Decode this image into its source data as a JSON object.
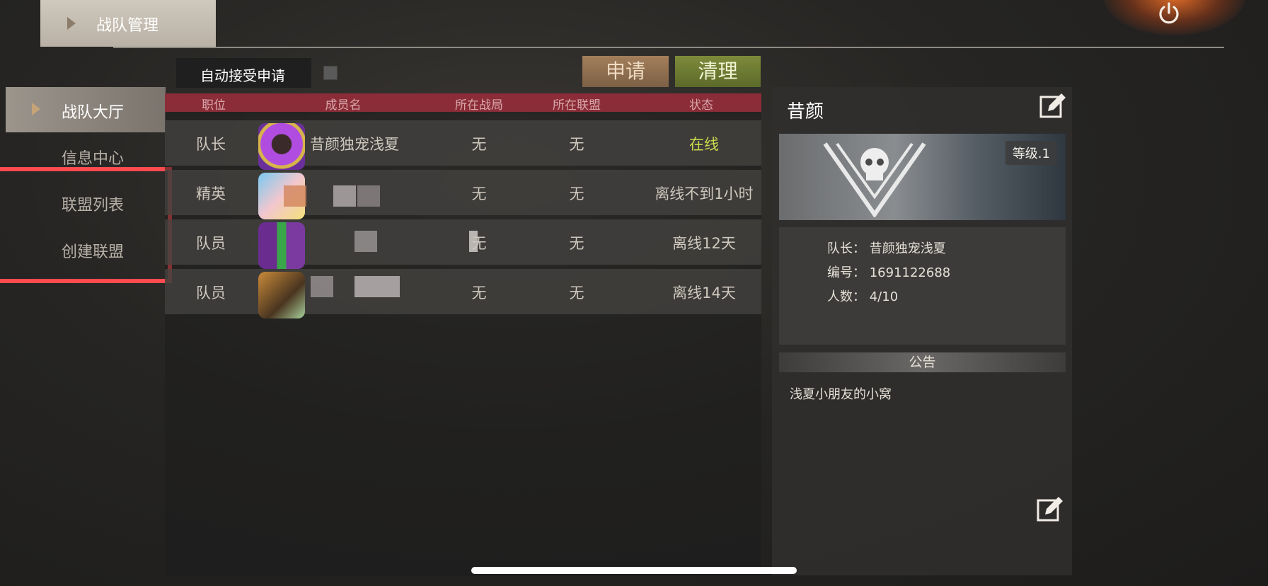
{
  "header": {
    "title": "战队管理"
  },
  "sidebar": {
    "items": [
      {
        "label": "战队大厅",
        "active": true
      },
      {
        "label": "信息中心",
        "active": false
      },
      {
        "label": "联盟列表",
        "active": false
      },
      {
        "label": "创建联盟",
        "active": false
      }
    ]
  },
  "toolbar": {
    "auto_accept_label": "自动接受申请",
    "auto_accept_checked": false,
    "apply_label": "申请",
    "clear_label": "清理"
  },
  "table": {
    "columns": [
      "职位",
      "成员名",
      "所在战局",
      "所在联盟",
      "状态"
    ],
    "rows": [
      {
        "role": "队长",
        "name": "昔颜独宠浅夏",
        "match": "无",
        "alliance": "无",
        "status": "在线"
      },
      {
        "role": "精英",
        "name": "",
        "match": "无",
        "alliance": "无",
        "status": "离线不到1小时"
      },
      {
        "role": "队员",
        "name": "",
        "match": "无",
        "alliance": "无",
        "status": "离线12天"
      },
      {
        "role": "队员",
        "name": "",
        "match": "无",
        "alliance": "无",
        "status": "离线14天"
      }
    ]
  },
  "team": {
    "name": "昔颜",
    "level": "等级.1",
    "captain_line": "队长： 昔颜独宠浅夏",
    "id_line": "编号： 1691122688",
    "members_line": "人数： 4/10",
    "notice_title": "公告",
    "notice_text": "浅夏小朋友的小窝"
  },
  "colors": {
    "table_header": "#8b2c38",
    "online": "#c7d84a",
    "apply_button": "#a37f5b",
    "clear_button": "#7e8a3a",
    "highlight": "#ff4a4f"
  },
  "icons": [
    "power-icon",
    "edit-icon",
    "skull-emblem-icon",
    "chevron-right-icon"
  ]
}
